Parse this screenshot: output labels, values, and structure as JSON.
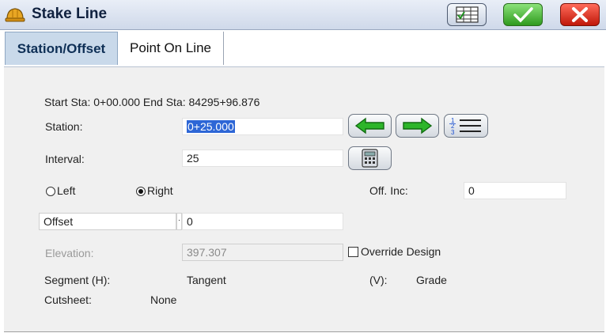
{
  "window": {
    "title": "Stake Line"
  },
  "icons": {
    "title": "hardhat-icon",
    "grid": "grid-check-icon",
    "ok": "checkmark-icon",
    "close": "close-x-icon",
    "prev": "left-arrow-icon",
    "next": "right-arrow-icon",
    "list": "numbered-list-icon",
    "calc": "calculator-icon"
  },
  "colors": {
    "tab_active": "#c9d9ea",
    "ok_green": "#3bb02a",
    "close_red": "#e0281a",
    "arrow_green": "#2db52a"
  },
  "tabs": [
    {
      "label": "Station/Offset",
      "active": true
    },
    {
      "label": "Point On Line",
      "active": false
    }
  ],
  "form": {
    "range_text": "Start Sta: 0+00.000 End Sta: 84295+96.876",
    "station": {
      "label": "Station:",
      "value": "0+25.000"
    },
    "interval": {
      "label": "Interval:",
      "value": "25"
    },
    "side": {
      "left_label": "Left",
      "right_label": "Right",
      "selected": "Right"
    },
    "off_inc": {
      "label": "Off. Inc:",
      "value": "0"
    },
    "offset": {
      "mode": "Offset",
      "value": "0"
    },
    "elevation": {
      "label": "Elevation:",
      "value": "397.307"
    },
    "override": {
      "label": "Override Design",
      "checked": false
    },
    "segment_h": {
      "label": "Segment (H):",
      "value": "Tangent"
    },
    "segment_v": {
      "label": "(V):",
      "value": "Grade"
    },
    "cutsheet": {
      "label": "Cutsheet:",
      "value": "None"
    }
  }
}
